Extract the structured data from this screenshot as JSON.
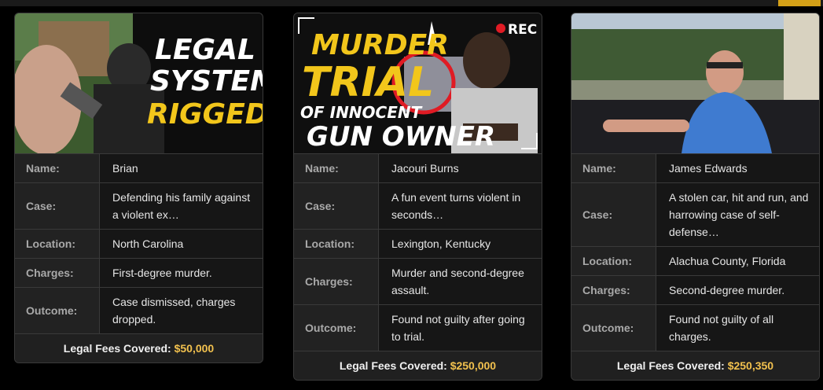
{
  "colors": {
    "fee_amount": "#f2c14e",
    "accent": "#d4a017",
    "card_bg": "#1b1b1b",
    "border": "#3a3a3a"
  },
  "labels": {
    "name": "Name:",
    "case": "Case:",
    "location": "Location:",
    "charges": "Charges:",
    "outcome": "Outcome:",
    "fees": "Legal Fees Covered:"
  },
  "cards": [
    {
      "thumb": {
        "lines": [
          "LEGAL",
          "SYSTEM",
          "RIGGED?"
        ]
      },
      "name": "Brian",
      "case": "Defending his family against a violent ex…",
      "location": "North Carolina",
      "charges": "First-degree murder.",
      "outcome": "Case dismissed, charges dropped.",
      "fees": "$50,000"
    },
    {
      "thumb": {
        "lines": [
          "MURDER",
          "TRIAL",
          "OF INNOCENT",
          "GUN OWNER"
        ],
        "rec": "REC"
      },
      "name": "Jacouri Burns",
      "case": "A fun event turns violent in seconds…",
      "location": "Lexington, Kentucky",
      "charges": "Murder and second-degree assault.",
      "outcome": "Found not guilty after going to trial.",
      "fees": "$250,000"
    },
    {
      "thumb": {},
      "name": "James Edwards",
      "case": "A stolen car, hit and run, and harrowing case of self-defense…",
      "location": "Alachua County, Florida",
      "charges": "Second-degree murder.",
      "outcome": "Found not guilty of all charges.",
      "fees": "$250,350"
    }
  ]
}
